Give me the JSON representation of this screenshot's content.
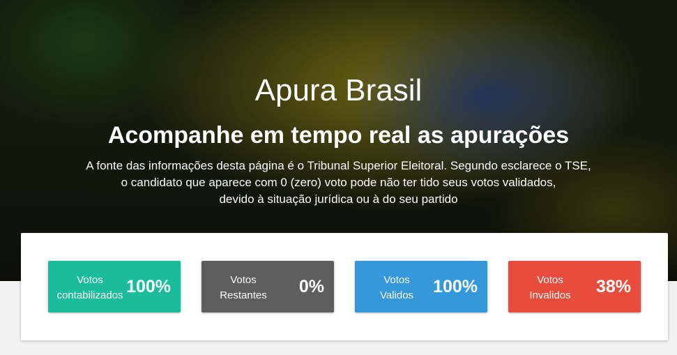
{
  "hero": {
    "title": "Apura Brasil",
    "subtitle": "Acompanhe em tempo real as apurações",
    "description_lines": [
      "A fonte das informações desta página é o Tribunal Superior Eleitoral. Segundo esclarece o TSE,",
      "o candidato que aparece com 0 (zero) voto pode não ter tido seus votos validados,",
      "devido à situação jurídica ou à do seu partido"
    ]
  },
  "stats": [
    {
      "label_lines": [
        "Votos",
        "contabilizados"
      ],
      "value": "100%",
      "color": "#1abc9c"
    },
    {
      "label_lines": [
        "Votos",
        "Restantes"
      ],
      "value": "0%",
      "color": "#5e5e5e"
    },
    {
      "label_lines": [
        "Votos",
        "Validos"
      ],
      "value": "100%",
      "color": "#3598db"
    },
    {
      "label_lines": [
        "Votos",
        "Invalidos"
      ],
      "value": "38%",
      "color": "#e74c3c"
    }
  ]
}
